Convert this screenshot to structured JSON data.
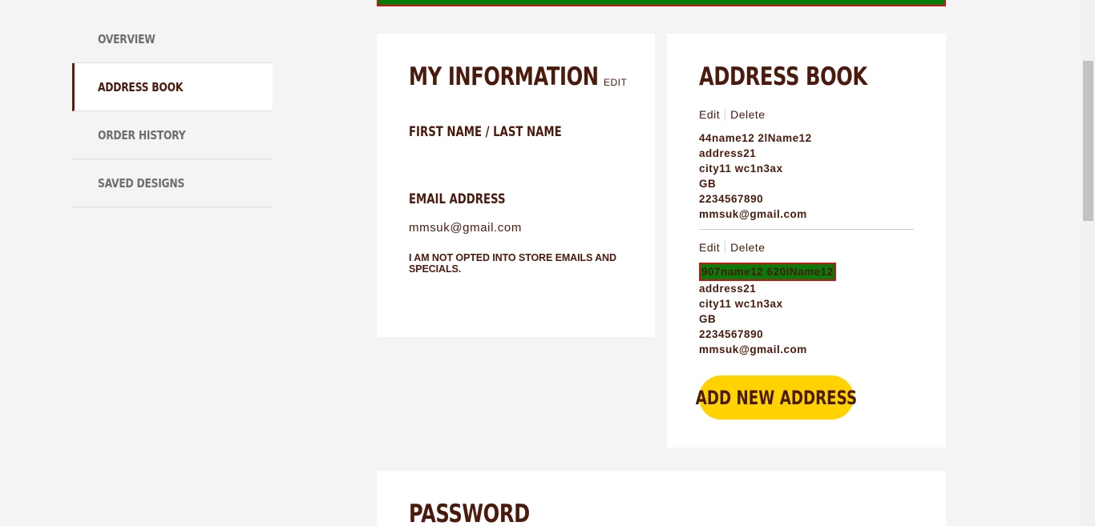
{
  "sidebar": {
    "items": [
      {
        "label": "OVERVIEW"
      },
      {
        "label": "ADDRESS BOOK"
      },
      {
        "label": "ORDER HISTORY"
      },
      {
        "label": "SAVED DESIGNS"
      }
    ]
  },
  "info": {
    "title": "MY INFORMATION",
    "edit_label": "EDIT",
    "name_label": "FIRST NAME / LAST NAME",
    "email_label": "EMAIL ADDRESS",
    "email_value": "mmsuk@gmail.com",
    "opt_status": "I AM NOT OPTED INTO STORE EMAILS AND SPECIALS."
  },
  "address_book": {
    "title": "ADDRESS BOOK",
    "addresses": [
      {
        "edit_label": "Edit",
        "delete_label": "Delete",
        "name": "44name12 2lName12",
        "street": "address21",
        "city_postcode": "city11 wc1n3ax",
        "country": "GB",
        "phone": "2234567890",
        "email": "mmsuk@gmail.com"
      },
      {
        "edit_label": "Edit",
        "delete_label": "Delete",
        "name": "907name12 620lName12",
        "street": "address21",
        "city_postcode": "city11 wc1n3ax",
        "country": "GB",
        "phone": "2234567890",
        "email": "mmsuk@gmail.com"
      }
    ],
    "add_button_label": "ADD NEW ADDRESS"
  },
  "password": {
    "title": "PASSWORD"
  },
  "colors": {
    "brand_brown": "#4a1a0c",
    "accent_yellow": "#ffd200",
    "highlight_green": "#0a7a0a",
    "highlight_red": "#c81414"
  }
}
